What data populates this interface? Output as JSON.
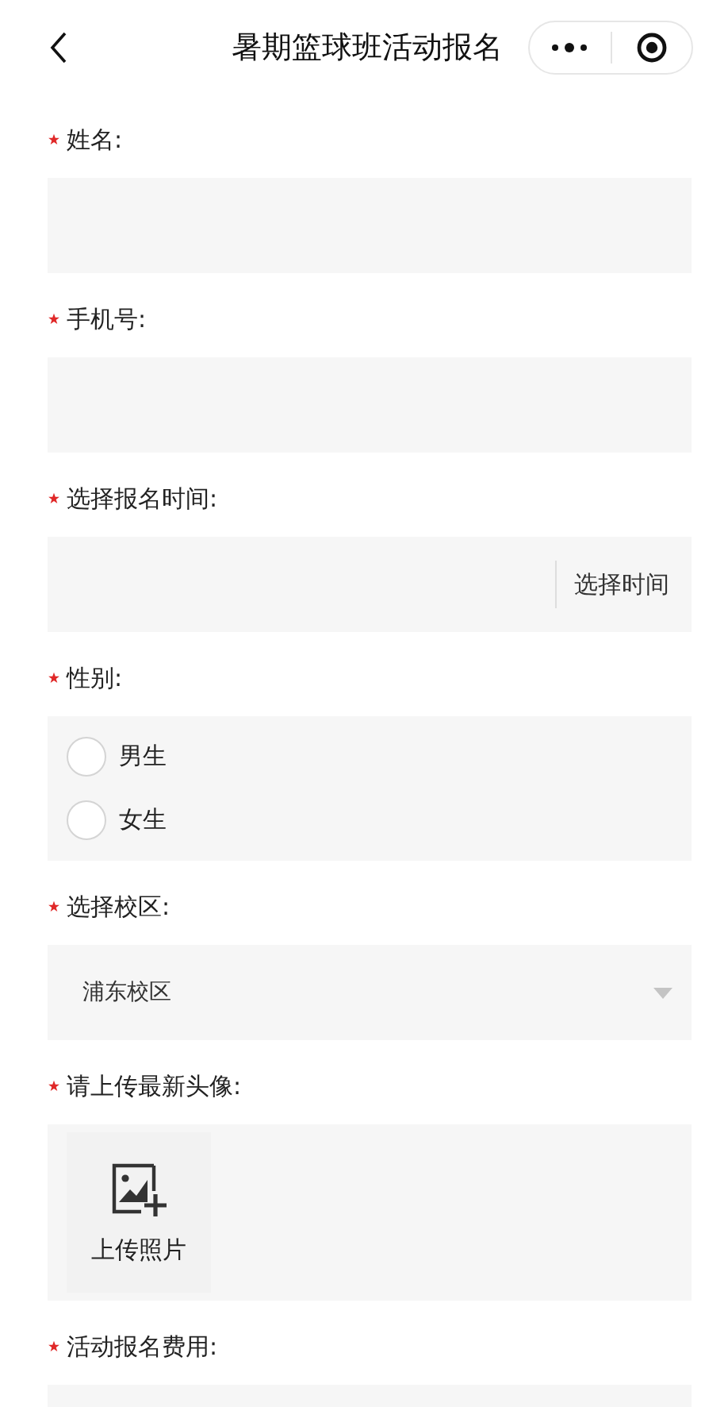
{
  "nav": {
    "title": "暑期篮球班活动报名"
  },
  "fields": [
    {
      "kind": "text",
      "label": "姓名:",
      "required": true
    },
    {
      "kind": "text",
      "label": "手机号:",
      "required": true
    },
    {
      "kind": "time",
      "label": "选择报名时间:",
      "required": true,
      "button": "选择时间"
    },
    {
      "kind": "radio",
      "label": "性别:",
      "required": true,
      "options": [
        {
          "label": "男生",
          "selected": false
        },
        {
          "label": "女生",
          "selected": false
        }
      ]
    },
    {
      "kind": "select",
      "label": "选择校区:",
      "required": true,
      "value": "浦东校区"
    },
    {
      "kind": "upload",
      "label": "请上传最新头像:",
      "required": true,
      "button": "上传照片"
    },
    {
      "kind": "text",
      "label": "活动报名费用:",
      "required": true
    }
  ]
}
